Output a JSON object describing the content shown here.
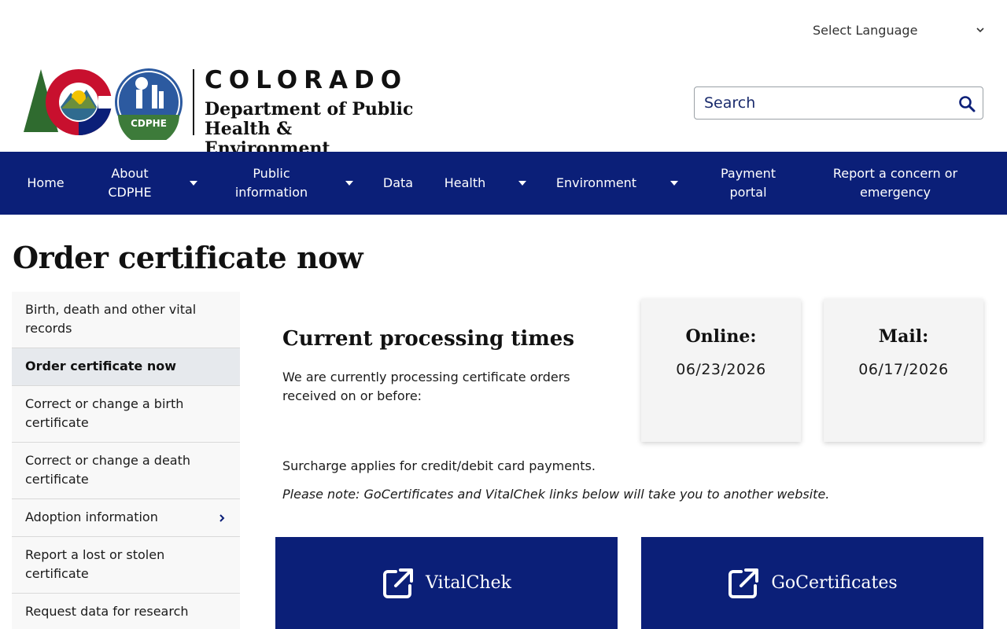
{
  "language": {
    "label": "Select Language"
  },
  "header": {
    "state_name": "COLORADO",
    "department": "Department of Public Health & Environment",
    "seal_text": "CDPHE",
    "colors": {
      "navy": "#0b1f78",
      "seal_blue": "#2c5aa0",
      "seal_green": "#3d7b3a",
      "logo_red": "#c8102e",
      "logo_gold": "#f2c300",
      "logo_green": "#2f6b2f"
    }
  },
  "search": {
    "placeholder": "Search"
  },
  "nav": {
    "home": "Home",
    "about": "About CDPHE",
    "public_info": "Public information",
    "data": "Data",
    "health": "Health",
    "environment": "Environment",
    "payment": "Payment portal",
    "report": "Report a concern or emergency"
  },
  "page": {
    "title": "Order certificate now"
  },
  "sidebar": {
    "items": [
      {
        "label": "Birth, death and other vital records"
      },
      {
        "label": "Order certificate now"
      },
      {
        "label": "Correct or change a birth certificate"
      },
      {
        "label": "Correct or change a death certificate"
      },
      {
        "label": "Adoption information"
      },
      {
        "label": "Report a lost or stolen certificate"
      },
      {
        "label": "Request data for research"
      }
    ]
  },
  "processing": {
    "title": "Current processing times",
    "description": "We are currently processing certificate orders received on or before:",
    "online_label": "Online:",
    "online_date": "06/23/2026",
    "mail_label": "Mail:",
    "mail_date": "06/17/2026"
  },
  "notes": {
    "surcharge": "Surcharge applies for credit/debit card payments.",
    "external": "Please note: GoCertificates and VitalChek links below will take you to another website."
  },
  "links": {
    "vitalchek": "VitalChek",
    "gocertificates": "GoCertificates"
  }
}
